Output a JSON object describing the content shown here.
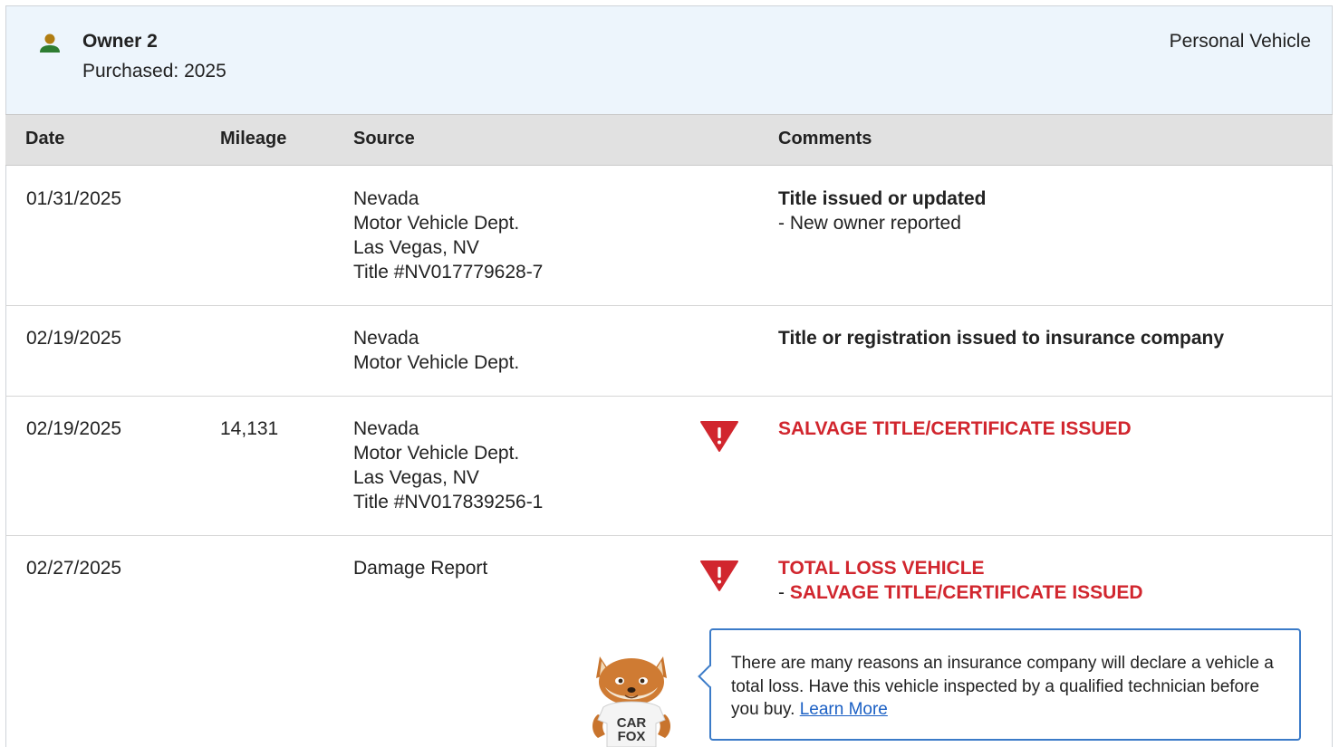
{
  "owner": {
    "name": "Owner 2",
    "purchased": "Purchased: 2025",
    "vehicle_type": "Personal Vehicle",
    "icon": "person-icon",
    "icon_color": "#2e7d32"
  },
  "table": {
    "headers": {
      "date": "Date",
      "mileage": "Mileage",
      "source": "Source",
      "comments": "Comments"
    },
    "rows": [
      {
        "date": "01/31/2025",
        "mileage": "",
        "source": [
          "Nevada",
          "Motor Vehicle Dept.",
          "Las Vegas, NV",
          "Title #NV017779628-7"
        ],
        "comment_title": "Title issued or updated",
        "comment_sub": "- New owner reported"
      },
      {
        "date": "02/19/2025",
        "mileage": "",
        "source": [
          "Nevada",
          "Motor Vehicle Dept."
        ],
        "comment_title": "Title or registration issued to insurance company"
      },
      {
        "date": "02/19/2025",
        "mileage": "14,131",
        "source": [
          "Nevada",
          "Motor Vehicle Dept.",
          "Las Vegas, NV",
          "Title #NV017839256-1"
        ],
        "alert_title": "SALVAGE TITLE/CERTIFICATE ISSUED"
      },
      {
        "date": "02/27/2025",
        "mileage": "",
        "source": [
          "Damage Report"
        ],
        "alert_title": "TOTAL LOSS VEHICLE",
        "alert_sub_dash": "- ",
        "alert_sub": "SALVAGE TITLE/CERTIFICATE ISSUED"
      }
    ]
  },
  "callout": {
    "text": "There are many reasons an insurance company will declare a vehicle a total loss. Have this vehicle inspected by a qualified technician before you buy. ",
    "link": "Learn More"
  },
  "mascot": {
    "shirt_line1": "CAR",
    "shirt_line2": "FOX"
  },
  "colors": {
    "alert_red": "#d1262e",
    "link_blue": "#1a5fc4",
    "header_bg": "#edf5fc",
    "table_head_bg": "#e1e1e1",
    "callout_border": "#3b7bc8"
  }
}
